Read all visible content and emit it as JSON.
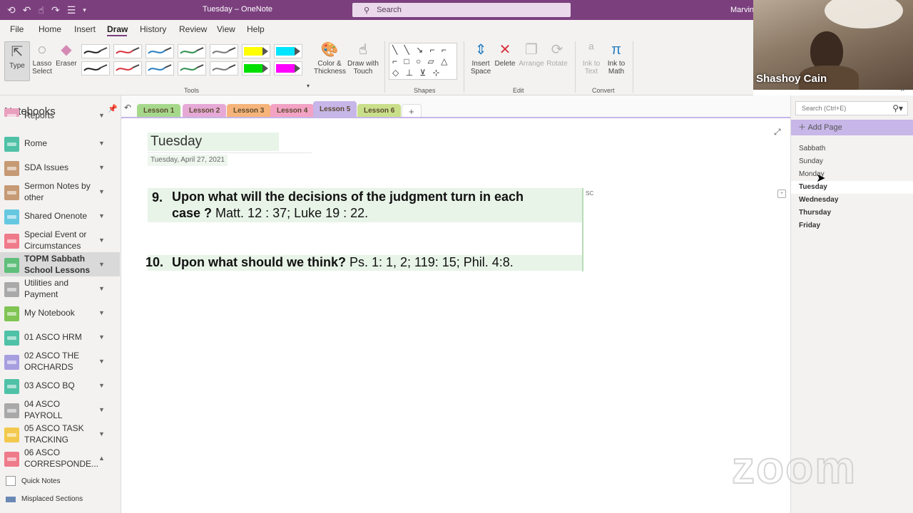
{
  "window": {
    "title": "Tuesday – OneNote",
    "search_placeholder": "Search",
    "user": "Marvin"
  },
  "ribbon_tabs": [
    "File",
    "Home",
    "Insert",
    "Draw",
    "History",
    "Review",
    "View",
    "Help"
  ],
  "active_ribbon_tab": "Draw",
  "ribbon": {
    "type": "Type",
    "lasso": "Lasso Select",
    "eraser": "Eraser",
    "color_thickness": "Color & Thickness",
    "draw_touch": "Draw with Touch",
    "insert_space": "Insert Space",
    "delete": "Delete",
    "arrange": "Arrange",
    "rotate": "Rotate",
    "ink_to_text": "Ink to Text",
    "ink_to_math": "Ink to Math",
    "groups": {
      "tools": "Tools",
      "shapes": "Shapes",
      "edit": "Edit",
      "convert": "Convert"
    },
    "pen_colors": [
      "#222222",
      "#d9343e",
      "#2a7fc1",
      "#2f8f4e",
      "#7a7a7a",
      "#ffff00",
      "#00e5ff",
      "#222222",
      "#d9343e",
      "#2a7fc1",
      "#2f8f4e",
      "#7a7a7a",
      "#00e000",
      "#ff00ff"
    ]
  },
  "video": {
    "name": "Shashoy Cain"
  },
  "notebooks": {
    "heading": "Notebooks",
    "items": [
      {
        "label": "Reports",
        "color": "#e8a0bd"
      },
      {
        "label": "Rome",
        "color": "#4fc1a6"
      },
      {
        "label": "SDA Issues",
        "color": "#c69a74"
      },
      {
        "label": "Sermon Notes by other",
        "color": "#c69a74"
      },
      {
        "label": "Shared Onenote",
        "color": "#66c8e0"
      },
      {
        "label": "Special Event or Circumstances",
        "color": "#ef7a8a"
      },
      {
        "label": "TOPM Sabbath School Lessons",
        "color": "#5fbf7a"
      },
      {
        "label": "Utilities and Payment",
        "color": "#a9a9a9"
      },
      {
        "label": "My Notebook",
        "color": "#80c453"
      },
      {
        "label": "01 ASCO HRM",
        "color": "#4fc1a6"
      },
      {
        "label": "02 ASCO THE ORCHARDS",
        "color": "#a79ee0"
      },
      {
        "label": "03 ASCO BQ",
        "color": "#4fc1a6"
      },
      {
        "label": "04 ASCO PAYROLL",
        "color": "#a9a9a9"
      },
      {
        "label": "05 ASCO TASK TRACKING",
        "color": "#f2c94c"
      },
      {
        "label": "06 ASCO CORRESPONDE...",
        "color": "#ef7a8a"
      }
    ],
    "quick_notes": "Quick Notes",
    "misplaced": "Misplaced Sections"
  },
  "sections": [
    {
      "label": "Lesson 1",
      "color": "#a6d88c"
    },
    {
      "label": "Lesson 2",
      "color": "#e6a9d6"
    },
    {
      "label": "Lesson 3",
      "color": "#f6b47a"
    },
    {
      "label": "Lesson 4",
      "color": "#f3a2c4"
    },
    {
      "label": "Lesson 5",
      "color": "#c7b6e8"
    },
    {
      "label": "Lesson 6",
      "color": "#c9df8a"
    }
  ],
  "active_section": "Lesson 5",
  "page": {
    "title": "Tuesday",
    "date": "Tuesday, April 27, 2021",
    "author_initials": "SC",
    "q9_num": "9.",
    "q9_bold_1": "Upon what will the decisions of the judgment turn in each",
    "q9_bold_2": "case ?",
    "q9_ref": " Matt. 12 : 37; Luke 19 : 22.",
    "q10_num": "10.",
    "q10_bold": "Upon what should we think?",
    "q10_ref": " Ps. 1: 1, 2; 119: 15; Phil. 4:8."
  },
  "pages_pane": {
    "search_placeholder": "Search (Ctrl+E)",
    "add_page": "Add Page",
    "pages": [
      "Sabbath",
      "Sunday",
      "Monday",
      "Tuesday",
      "Wednesday",
      "Thursday",
      "Friday"
    ],
    "active_page": "Tuesday"
  },
  "zoom_watermark": "zoom"
}
